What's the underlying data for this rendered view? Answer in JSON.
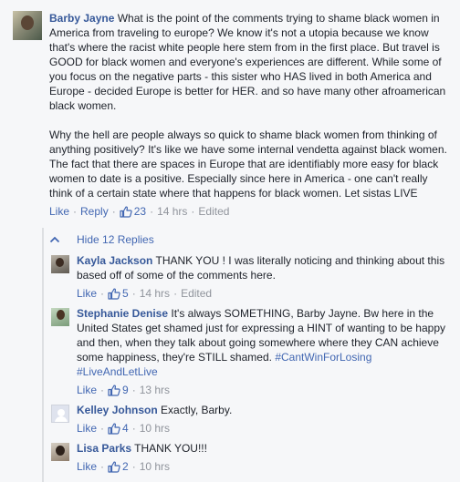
{
  "colors": {
    "link": "#4267b2",
    "author": "#365899",
    "meta": "#90949c",
    "background": "#f6f7f9"
  },
  "main_comment": {
    "author": "Barby Jayne",
    "paragraph1": "What is the point of the comments trying to shame black women in America from traveling to europe? We know it's not a utopia because we know that's where the racist white people here stem from in the first place. But travel is GOOD for black women and everyone's experiences are different. While some of you focus on the negative parts - this sister who HAS lived in both America and Europe - decided Europe is better for HER. and so have many other afroamerican black women.",
    "paragraph2": "Why the hell are people always so quick to shame black women from thinking of anything positively? It's like we have some internal vendetta against black women. The fact that there are spaces in Europe that are identifiably more easy for black women to date is a positive. Especially since here in America - one can't really think of a certain state where that happens for black women. Let sistas LIVE",
    "like_label": "Like",
    "reply_label": "Reply",
    "like_count": "23",
    "time": "14 hrs",
    "edited_label": "Edited"
  },
  "replies_toggle": {
    "label": "Hide 12 Replies",
    "icon": "chevron-up-icon"
  },
  "replies": [
    {
      "author": "Kayla Jackson",
      "text": "THANK YOU ! I was literally noticing and thinking about this based off of some of the comments here.",
      "like_label": "Like",
      "like_count": "5",
      "time": "14 hrs",
      "edited_label": "Edited"
    },
    {
      "author": "Stephanie Denise",
      "text": "It's always SOMETHING, Barby Jayne. Bw here in the United States get shamed just for expressing a HINT of wanting to be happy and then, when they talk about going somewhere where they CAN achieve some happiness, they're STILL shamed.",
      "hashtags": "#CantWinForLosing #LiveAndLetLive",
      "like_label": "Like",
      "like_count": "9",
      "time": "13 hrs"
    },
    {
      "author": "Kelley Johnson",
      "text": "Exactly, Barby.",
      "like_label": "Like",
      "like_count": "4",
      "time": "10 hrs"
    },
    {
      "author": "Lisa Parks",
      "text": "THANK YOU!!!",
      "like_label": "Like",
      "like_count": "2",
      "time": "10 hrs"
    }
  ]
}
